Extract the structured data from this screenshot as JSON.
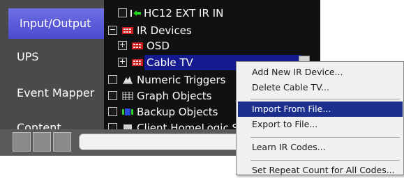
{
  "sidebar": {
    "items": [
      {
        "label": "Input/Output",
        "active": true
      },
      {
        "label": "UPS",
        "active": false
      },
      {
        "label": "Event Mapper",
        "active": false
      },
      {
        "label": "Content",
        "active": false
      }
    ]
  },
  "tree": {
    "rows": [
      {
        "label": "HC12 EXT IR IN",
        "icon": "ir-input-icon"
      },
      {
        "label": "IR Devices",
        "icon": "ir-device-icon"
      },
      {
        "label": "OSD",
        "icon": "ir-device-icon"
      },
      {
        "label": "Cable TV",
        "icon": "ir-device-icon",
        "selected": true
      },
      {
        "label": "Numeric Triggers",
        "icon": "numeric-trigger-icon"
      },
      {
        "label": "Graph Objects",
        "icon": "graph-object-icon"
      },
      {
        "label": "Backup Objects",
        "icon": "backup-object-icon"
      },
      {
        "label": "Client HomeLogic S",
        "icon": "client-icon"
      }
    ]
  },
  "context_menu": {
    "items": [
      {
        "label": "Add New IR Device..."
      },
      {
        "label": "Delete Cable TV..."
      },
      {
        "label": "Import From File..."
      },
      {
        "label": "Export to File..."
      },
      {
        "label": "Learn IR Codes..."
      },
      {
        "label": "Set Repeat Count for All Codes..."
      }
    ],
    "highlighted": "Import From File..."
  },
  "colors": {
    "sidebar_bg": "#4a4a4a",
    "active_nav": "#5a5ad8",
    "tree_bg": "#111111",
    "selection": "#141a8f",
    "menu_highlight": "#1c2f8c"
  }
}
